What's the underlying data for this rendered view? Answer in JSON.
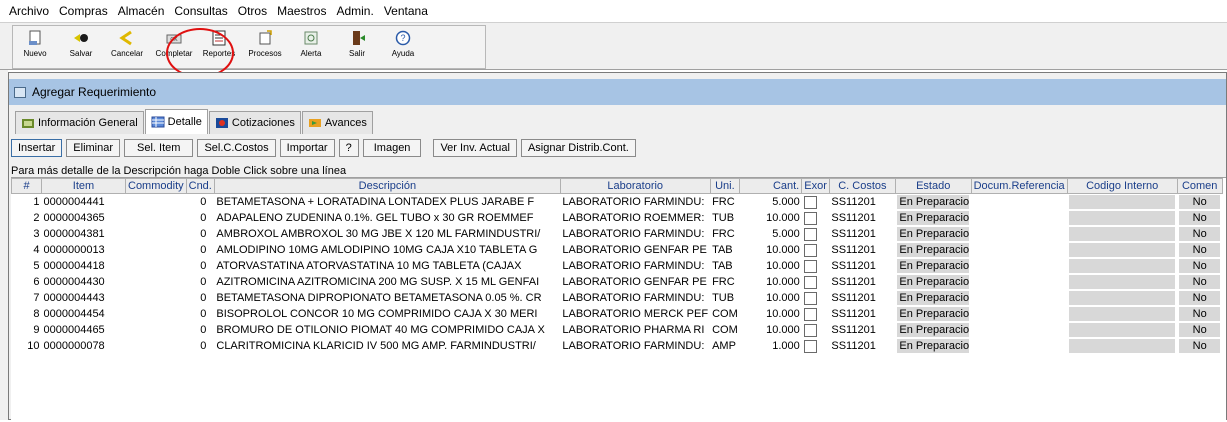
{
  "menu": [
    "Archivo",
    "Compras",
    "Almacén",
    "Consultas",
    "Otros",
    "Maestros",
    "Admin.",
    "Ventana"
  ],
  "toolbar": [
    {
      "label": "Nuevo",
      "icon": "new-document-icon"
    },
    {
      "label": "Salvar",
      "icon": "save-icon"
    },
    {
      "label": "Cancelar",
      "icon": "cancel-icon"
    },
    {
      "label": "Completar",
      "icon": "complete-icon"
    },
    {
      "label": "Reportes",
      "icon": "reports-icon"
    },
    {
      "label": "Procesos",
      "icon": "processes-icon"
    },
    {
      "label": "Alerta",
      "icon": "alert-icon"
    },
    {
      "label": "Salir",
      "icon": "exit-icon"
    },
    {
      "label": "Ayuda",
      "icon": "help-icon"
    }
  ],
  "window": {
    "title": "Agregar Requerimiento"
  },
  "tabs": [
    "Información General",
    "Detalle",
    "Cotizaciones",
    "Avances"
  ],
  "actions": [
    "Insertar",
    "Eliminar",
    "Sel. Item",
    "Sel.C.Costos",
    "Importar",
    "?",
    "Imagen",
    "Ver Inv. Actual",
    "Asignar Distrib.Cont."
  ],
  "hint": "Para más detalle de la Descripción haga Doble Click sobre una línea",
  "columns": [
    "#",
    "Item",
    "Commodity",
    "Cnd.",
    "Descripción",
    "Laboratorio",
    "Uni.",
    "Cant.",
    "Exor",
    "C. Costos",
    "Estado",
    "Docum.Referencia",
    "Codigo Interno",
    "Comen"
  ],
  "rows": [
    {
      "n": "1",
      "item": "0000004441",
      "cnd": "0",
      "desc": "BETAMETASONA + LORATADINA  LONTADEX PLUS JARABE F",
      "lab": "LABORATORIO FARMINDU:",
      "uni": "FRC",
      "cant": "5.000",
      "cc": "SS11201",
      "estado": "En Preparacio",
      "com": "No"
    },
    {
      "n": "2",
      "item": "0000004365",
      "cnd": "0",
      "desc": "ADAPALENO  ZUDENINA 0.1%. GEL  TUBO x 30 GR  ROEMMEF",
      "lab": "LABORATORIO ROEMMER:",
      "uni": "TUB",
      "cant": "10.000",
      "cc": "SS11201",
      "estado": "En Preparacio",
      "com": "No"
    },
    {
      "n": "3",
      "item": "0000004381",
      "cnd": "0",
      "desc": "AMBROXOL AMBROXOL 30 MG JBE X 120 ML FARMINDUSTRI/",
      "lab": "LABORATORIO FARMINDU:",
      "uni": "FRC",
      "cant": "5.000",
      "cc": "SS11201",
      "estado": "En Preparacio",
      "com": "No"
    },
    {
      "n": "4",
      "item": "0000000013",
      "cnd": "0",
      "desc": "AMLODIPINO 10MG AMLODIPINO 10MG CAJA X10  TABLETA G",
      "lab": "LABORATORIO GENFAR PE",
      "uni": "TAB",
      "cant": "10.000",
      "cc": "SS11201",
      "estado": "En Preparacio",
      "com": "No"
    },
    {
      "n": "5",
      "item": "0000004418",
      "cnd": "0",
      "desc": "ATORVASTATINA ATORVASTATINA 10 MG TABLETA  (CAJAX",
      "lab": "LABORATORIO FARMINDU:",
      "uni": "TAB",
      "cant": "10.000",
      "cc": "SS11201",
      "estado": "En Preparacio",
      "com": "No"
    },
    {
      "n": "6",
      "item": "0000004430",
      "cnd": "0",
      "desc": "AZITROMICINA AZITROMICINA 200 MG SUSP. X 15 ML GENFAI",
      "lab": "LABORATORIO GENFAR PE",
      "uni": "FRC",
      "cant": "10.000",
      "cc": "SS11201",
      "estado": "En Preparacio",
      "com": "No"
    },
    {
      "n": "7",
      "item": "0000004443",
      "cnd": "0",
      "desc": "BETAMETASONA DIPROPIONATO BETAMETASONA 0.05 %. CR",
      "lab": "LABORATORIO FARMINDU:",
      "uni": "TUB",
      "cant": "10.000",
      "cc": "SS11201",
      "estado": "En Preparacio",
      "com": "No"
    },
    {
      "n": "8",
      "item": "0000004454",
      "cnd": "0",
      "desc": "BISOPROLOL  CONCOR 10 MG COMPRIMIDO CAJA X 30  MERI",
      "lab": "LABORATORIO MERCK PEF",
      "uni": "COM",
      "cant": "10.000",
      "cc": "SS11201",
      "estado": "En Preparacio",
      "com": "No"
    },
    {
      "n": "9",
      "item": "0000004465",
      "cnd": "0",
      "desc": "BROMURO DE OTILONIO PIOMAT 40 MG COMPRIMIDO CAJA X",
      "lab": "LABORATORIO PHARMA RI",
      "uni": "COM",
      "cant": "10.000",
      "cc": "SS11201",
      "estado": "En Preparacio",
      "com": "No"
    },
    {
      "n": "10",
      "item": "0000000078",
      "cnd": "0",
      "desc": "CLARITROMICINA KLARICID IV 500 MG AMP.  FARMINDUSTRI/",
      "lab": "LABORATORIO FARMINDU:",
      "uni": "AMP",
      "cant": "1.000",
      "cc": "SS11201",
      "estado": "En Preparacio",
      "com": "No"
    }
  ]
}
